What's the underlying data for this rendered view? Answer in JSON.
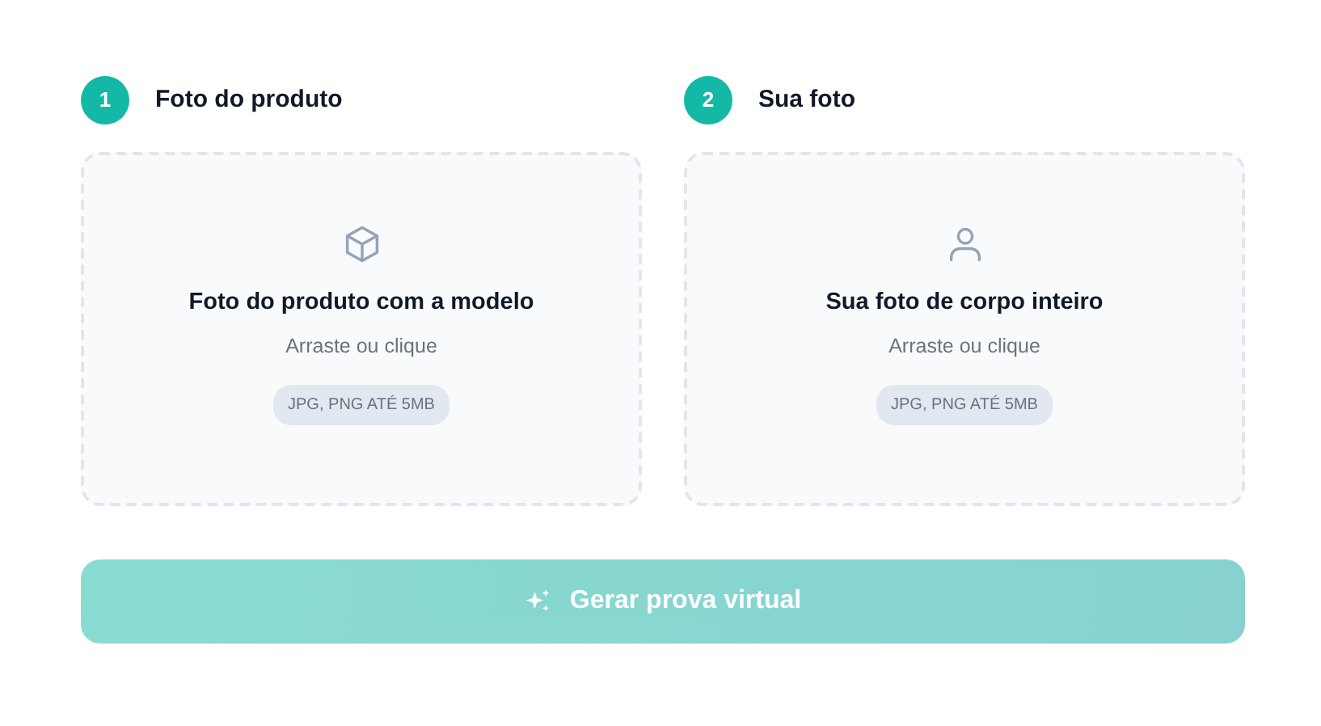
{
  "steps": [
    {
      "number": "1",
      "title": "Foto do produto",
      "upload": {
        "kind": "box",
        "title": "Foto do produto com a modelo",
        "hint": "Arraste ou clique",
        "formats": "JPG, PNG ATÉ 5MB"
      }
    },
    {
      "number": "2",
      "title": "Sua foto",
      "upload": {
        "kind": "person",
        "title": "Sua foto de corpo inteiro",
        "hint": "Arraste ou clique",
        "formats": "JPG, PNG ATÉ 5MB"
      }
    }
  ],
  "generate_button": {
    "label": "Gerar prova virtual",
    "disabled": true
  }
}
